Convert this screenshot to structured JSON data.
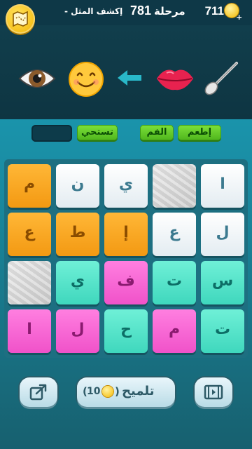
{
  "header": {
    "coins": "711",
    "level_label": "مرحلة",
    "level_number": "781",
    "level_subtitle": "- إكشف المثل",
    "coin_plus": "+"
  },
  "clues": {
    "icons": [
      "eye-icon",
      "smiling-face-icon",
      "arrow-left-icon",
      "lips-icon",
      "spoon-icon"
    ]
  },
  "answer": {
    "words": [
      "إطعم",
      "الفم",
      "تستحي"
    ],
    "empty_slots": 1
  },
  "grid": {
    "rows": [
      [
        {
          "letter": "م",
          "color": "orange"
        },
        {
          "letter": "ن",
          "color": "white"
        },
        {
          "letter": "ي",
          "color": "white"
        },
        {
          "letter": "",
          "color": "stone"
        },
        {
          "letter": "ا",
          "color": "white"
        }
      ],
      [
        {
          "letter": "ع",
          "color": "orange"
        },
        {
          "letter": "ط",
          "color": "orange"
        },
        {
          "letter": "إ",
          "color": "orange"
        },
        {
          "letter": "ع",
          "color": "white"
        },
        {
          "letter": "ل",
          "color": "white"
        }
      ],
      [
        {
          "letter": "",
          "color": "stone"
        },
        {
          "letter": "ي",
          "color": "teal"
        },
        {
          "letter": "ف",
          "color": "pink"
        },
        {
          "letter": "ت",
          "color": "teal"
        },
        {
          "letter": "س",
          "color": "teal"
        }
      ],
      [
        {
          "letter": "ا",
          "color": "pink"
        },
        {
          "letter": "ل",
          "color": "pink"
        },
        {
          "letter": "ح",
          "color": "teal"
        },
        {
          "letter": "م",
          "color": "pink"
        },
        {
          "letter": "ت",
          "color": "teal"
        }
      ]
    ]
  },
  "footer": {
    "hint_label": "تلميح",
    "hint_cost": "10",
    "share_icon": "share-icon",
    "video_icon": "film-icon"
  },
  "colors": {
    "orange": "#f7a11e",
    "white": "#f4f8fa",
    "teal": "#4fe2c7",
    "pink": "#f565d3",
    "word_chip": "#5fc726"
  }
}
